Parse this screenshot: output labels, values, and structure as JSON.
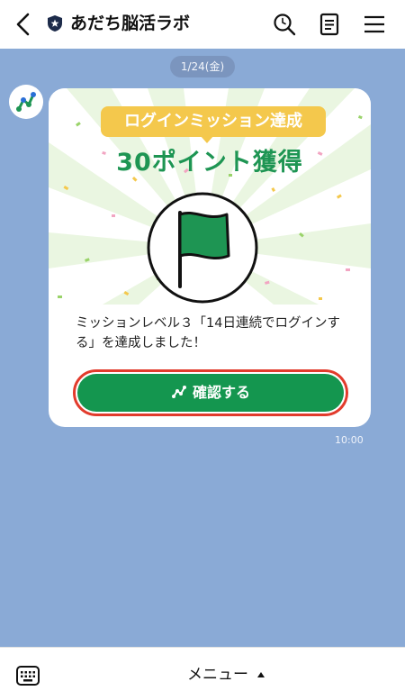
{
  "header": {
    "back_icon": "chevron-left-icon",
    "account_badge_icon": "shield-star-icon",
    "title": "あだち脳活ラボ",
    "actions": [
      "search-icon",
      "notes-icon",
      "menu-icon"
    ]
  },
  "chat": {
    "date": "1/24(金)",
    "message": {
      "ribbon": "ログインミッション達成",
      "points": "30ポイント獲得",
      "text": "ミッションレベル３「14日連続でログインする」を達成しました！",
      "button_label": "確認する",
      "time": "10:00"
    }
  },
  "footer": {
    "keyboard_icon": "keyboard-icon",
    "menu_label": "メニュー"
  },
  "colors": {
    "background": "#8aaad6",
    "brand_green": "#1e9553",
    "button_green": "#14964f",
    "ribbon_yellow": "#f4c84c",
    "highlight_red": "#e23b2c"
  }
}
